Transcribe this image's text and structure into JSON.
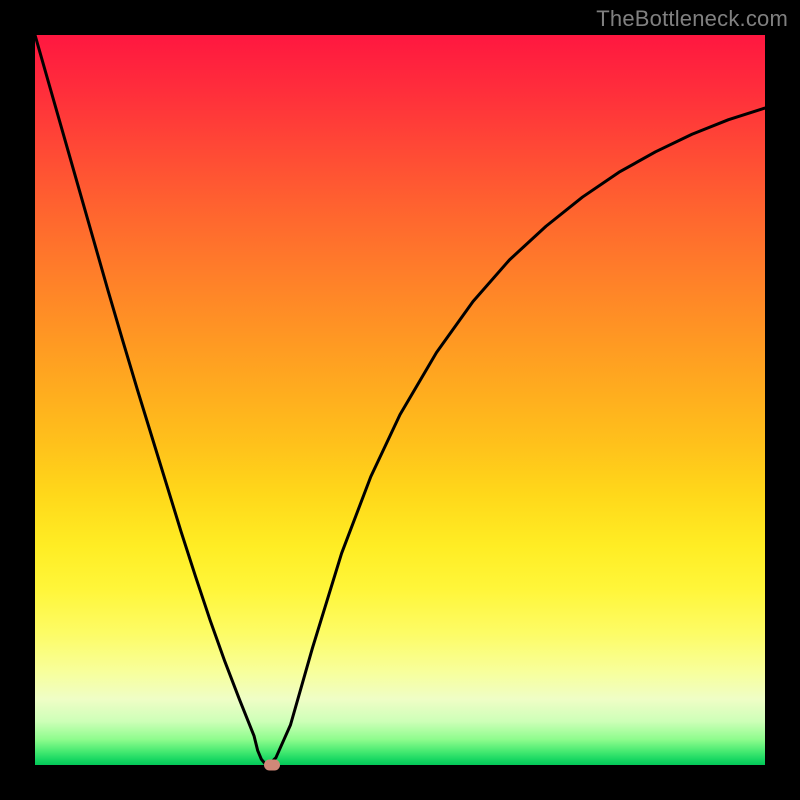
{
  "watermark": "TheBottleneck.com",
  "chart_data": {
    "type": "line",
    "title": "",
    "xlabel": "",
    "ylabel": "",
    "x": [
      0.0,
      0.02,
      0.04,
      0.06,
      0.08,
      0.1,
      0.12,
      0.14,
      0.16,
      0.18,
      0.2,
      0.22,
      0.24,
      0.26,
      0.28,
      0.3,
      0.305,
      0.31,
      0.315,
      0.32,
      0.33,
      0.35,
      0.38,
      0.42,
      0.46,
      0.5,
      0.55,
      0.6,
      0.65,
      0.7,
      0.75,
      0.8,
      0.85,
      0.9,
      0.95,
      1.0
    ],
    "values": [
      1.0,
      0.93,
      0.86,
      0.79,
      0.72,
      0.65,
      0.582,
      0.515,
      0.45,
      0.385,
      0.32,
      0.258,
      0.198,
      0.142,
      0.09,
      0.04,
      0.02,
      0.008,
      0.002,
      0.0,
      0.01,
      0.055,
      0.16,
      0.29,
      0.395,
      0.48,
      0.565,
      0.635,
      0.692,
      0.738,
      0.778,
      0.812,
      0.84,
      0.864,
      0.884,
      0.9
    ],
    "xlim": [
      0,
      1
    ],
    "ylim": [
      0,
      1
    ],
    "marker": {
      "x": 0.325,
      "y": 0.0
    },
    "gradient_colors": {
      "top": "#ff1740",
      "mid": "#ffd81a",
      "bottom": "#03c858"
    }
  }
}
